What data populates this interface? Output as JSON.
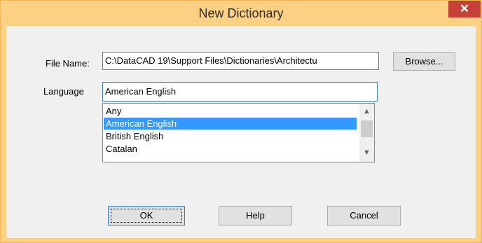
{
  "window": {
    "title": "New Dictionary",
    "close_glyph": "✕"
  },
  "file_name": {
    "label": "File Name:",
    "value": "C:\\DataCAD 19\\Support Files\\Dictionaries\\Architectu"
  },
  "browse_label": "Browse...",
  "language": {
    "label": "Language",
    "value": "American English",
    "options": [
      "Any",
      "American English",
      "British English",
      "Catalan"
    ],
    "selected_index": 1
  },
  "scroll_icons": {
    "up": "up-arrow-icon",
    "down": "down-arrow-icon"
  },
  "buttons": {
    "ok": "OK",
    "help": "Help",
    "cancel": "Cancel"
  },
  "colors": {
    "title_bg": "#fcd184",
    "close_bg": "#c8403a",
    "selection": "#3399ff"
  }
}
